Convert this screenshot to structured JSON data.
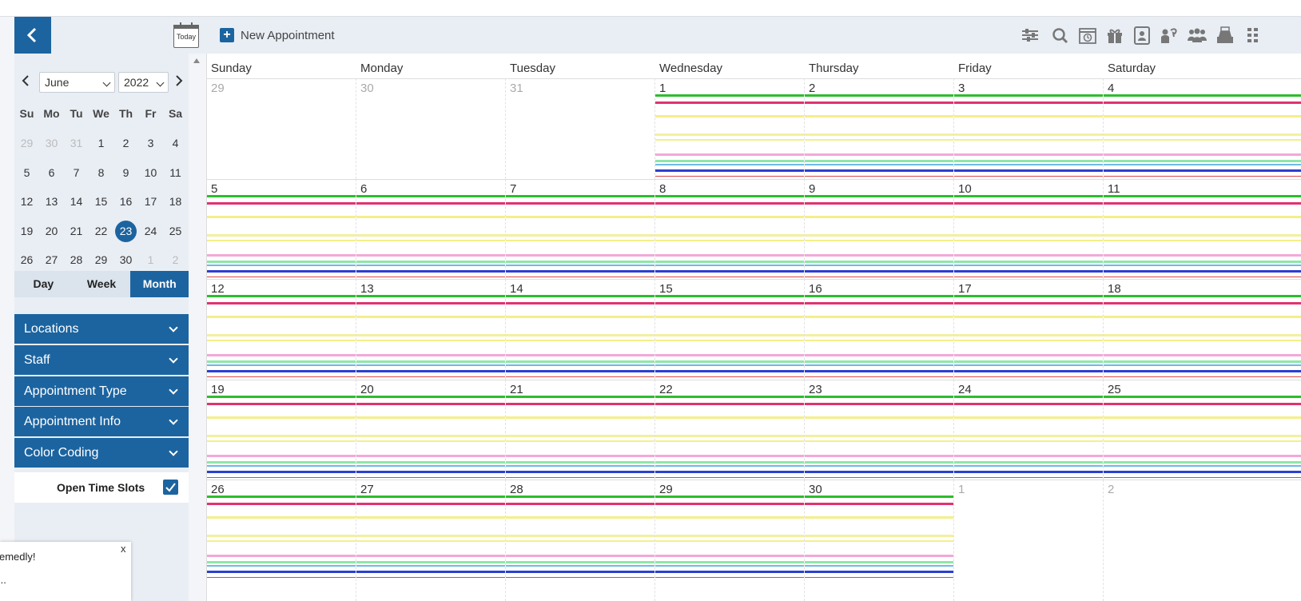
{
  "toolbar": {
    "today_label": "Today",
    "new_appointment_label": "New Appointment",
    "icons": [
      "settings-sliders-icon",
      "search-icon",
      "clock-calendar-icon",
      "gift-icon",
      "contact-card-icon",
      "client-call-icon",
      "group-icon",
      "cash-register-icon",
      "grid-menu-icon"
    ]
  },
  "mini_calendar": {
    "month": "June",
    "year": "2022",
    "weekdays": [
      "Su",
      "Mo",
      "Tu",
      "We",
      "Th",
      "Fr",
      "Sa"
    ],
    "weeks": [
      [
        "29",
        "30",
        "31",
        "1",
        "2",
        "3",
        "4"
      ],
      [
        "5",
        "6",
        "7",
        "8",
        "9",
        "10",
        "11"
      ],
      [
        "12",
        "13",
        "14",
        "15",
        "16",
        "17",
        "18"
      ],
      [
        "19",
        "20",
        "21",
        "22",
        "23",
        "24",
        "25"
      ],
      [
        "26",
        "27",
        "28",
        "29",
        "30",
        "1",
        "2"
      ]
    ],
    "selected_day": "23"
  },
  "view_tabs": [
    "Day",
    "Week",
    "Month"
  ],
  "active_view": "Month",
  "filters": [
    "Locations",
    "Staff",
    "Appointment Type",
    "Appointment Info",
    "Color Coding"
  ],
  "open_time_slots": {
    "label": "Open Time Slots",
    "checked": true
  },
  "toast": {
    "line1": "emedly!",
    "line2": "...",
    "close": "x"
  },
  "calendar": {
    "weekday_headers": [
      "Sunday",
      "Monday",
      "Tuesday",
      "Wednesday",
      "Thursday",
      "Friday",
      "Saturday"
    ],
    "weeks": [
      [
        "29",
        "30",
        "31",
        "1",
        "2",
        "3",
        "4"
      ],
      [
        "5",
        "6",
        "7",
        "8",
        "9",
        "10",
        "11"
      ],
      [
        "12",
        "13",
        "14",
        "15",
        "16",
        "17",
        "18"
      ],
      [
        "19",
        "20",
        "21",
        "22",
        "23",
        "24",
        "25"
      ],
      [
        "26",
        "27",
        "28",
        "29",
        "30",
        "1",
        "2"
      ]
    ]
  },
  "colors": {
    "accent": "#1c64a0",
    "appointment_bars": [
      "#2dbd2d",
      "#e0336e",
      "#f4ef8a",
      "#f3f0a0",
      "#f3a8d8",
      "#8fe6a8",
      "#6fb9e8",
      "#2a3fd1",
      "#d94a4a"
    ]
  }
}
